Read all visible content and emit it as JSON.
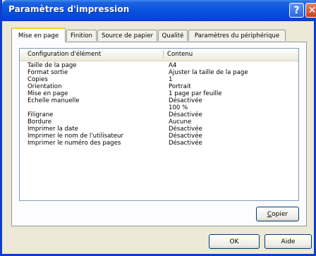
{
  "window": {
    "title": "Paramètres d'impression"
  },
  "titlebar": {
    "help_icon": "?",
    "close_icon": "✕"
  },
  "tabs": [
    {
      "label": "Mise en page",
      "active": true
    },
    {
      "label": "Finition",
      "active": false
    },
    {
      "label": "Source de papier",
      "active": false
    },
    {
      "label": "Qualité",
      "active": false
    },
    {
      "label": "Paramètres du périphérique",
      "active": false
    }
  ],
  "list": {
    "headers": [
      "Configuration d'élément",
      "Contenu"
    ],
    "rows": [
      {
        "key": "Taille de la page",
        "value": "A4"
      },
      {
        "key": "Format sortie",
        "value": "Ajuster la taille de la page"
      },
      {
        "key": "Copies",
        "value": "1"
      },
      {
        "key": "Orientation",
        "value": "Portrait"
      },
      {
        "key": "Mise en page",
        "value": "1 page par feuille"
      },
      {
        "key": "Echelle manuelle",
        "value": "Désactivée"
      },
      {
        "key": "",
        "value": "100 %"
      },
      {
        "key": "Filigrane",
        "value": "Désactivée"
      },
      {
        "key": "Bordure",
        "value": "Aucune"
      },
      {
        "key": "Imprimer la date",
        "value": "Désactivée"
      },
      {
        "key": "Imprimer le nom de l'utilisateur",
        "value": "Désactivée"
      },
      {
        "key": "Imprimer le numéro des pages",
        "value": "Désactivée"
      }
    ]
  },
  "buttons": {
    "copy_accel": "C",
    "copy_rest": "opier",
    "ok": "OK",
    "help": "Aide"
  }
}
